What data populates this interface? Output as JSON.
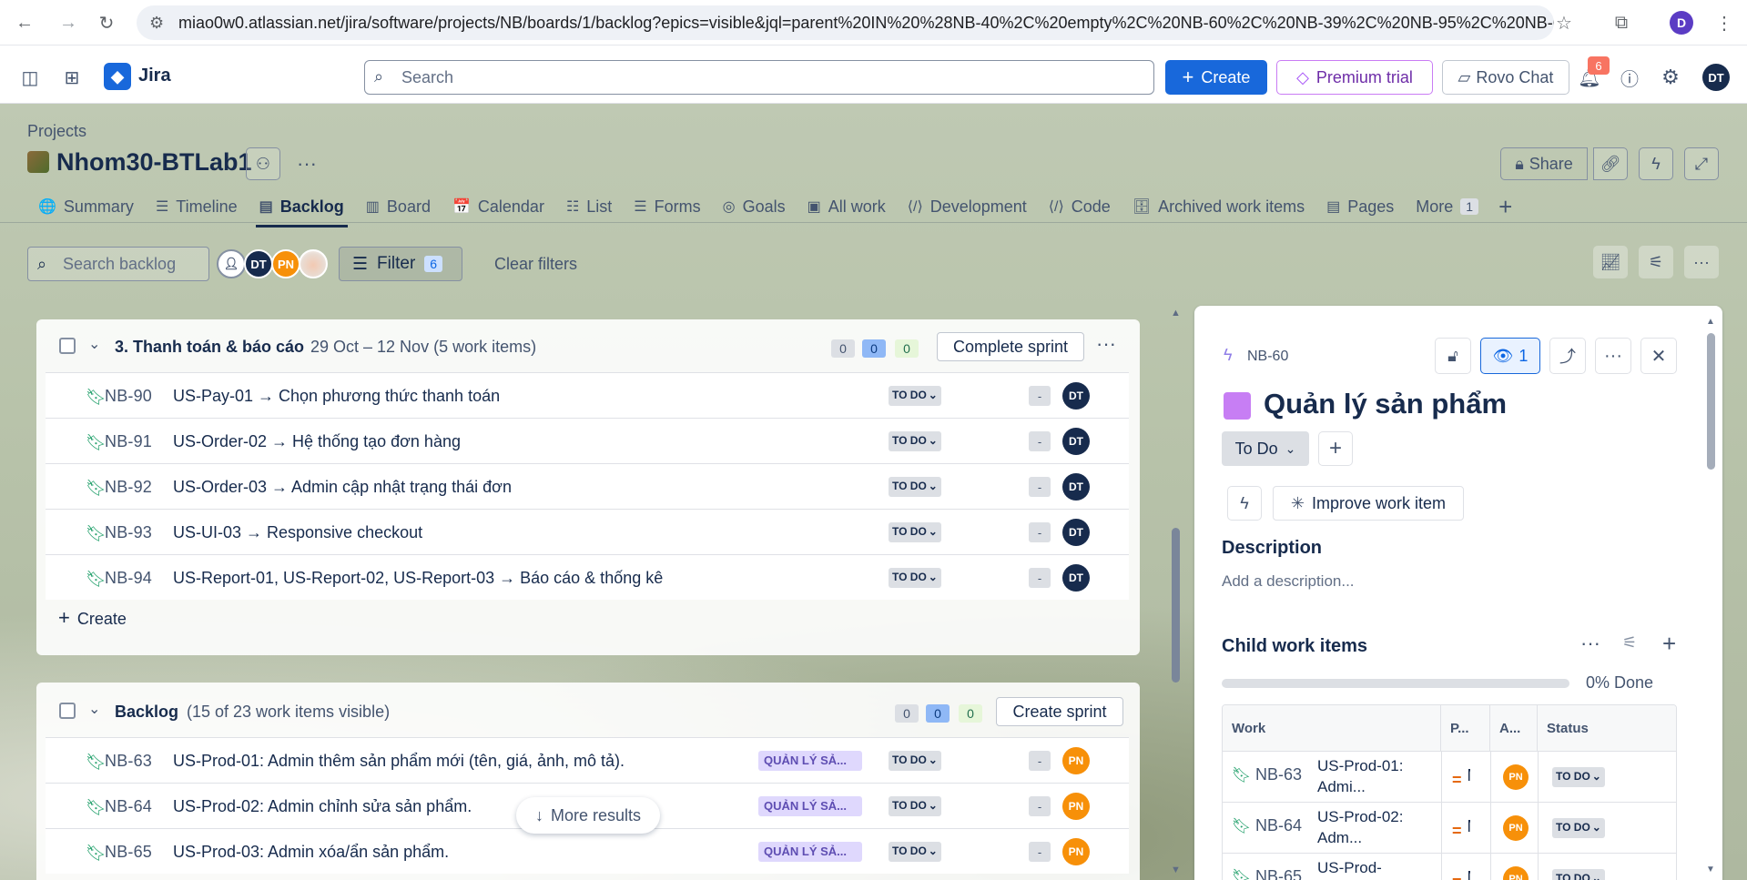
{
  "browser": {
    "url": "miao0w0.atlassian.net/jira/software/projects/NB/boards/1/backlog?epics=visible&jql=parent%20IN%20%28NB-40%2C%20empty%2C%20NB-60%2C%20NB-39%2C%20NB-95%2C%20NB-62%...",
    "profile_initial": "D"
  },
  "topnav": {
    "app_name": "Jira",
    "search_placeholder": "Search",
    "create_label": "Create",
    "premium_label": "Premium trial",
    "rovo_label": "Rovo Chat",
    "notification_count": "6",
    "avatar_initials": "DT"
  },
  "project": {
    "breadcrumb": "Projects",
    "name": "Nhom30-BTLab1",
    "share_label": "Share"
  },
  "tabs": [
    {
      "label": "Summary",
      "icon": "globe-icon",
      "glyph": "🌐"
    },
    {
      "label": "Timeline",
      "icon": "timeline-icon",
      "glyph": "☰"
    },
    {
      "label": "Backlog",
      "icon": "backlog-icon",
      "glyph": "▤",
      "active": true
    },
    {
      "label": "Board",
      "icon": "board-icon",
      "glyph": "▥"
    },
    {
      "label": "Calendar",
      "icon": "calendar-icon",
      "glyph": "📅"
    },
    {
      "label": "List",
      "icon": "list-icon",
      "glyph": "☷"
    },
    {
      "label": "Forms",
      "icon": "forms-icon",
      "glyph": "☰"
    },
    {
      "label": "Goals",
      "icon": "goals-icon",
      "glyph": "◎"
    },
    {
      "label": "All work",
      "icon": "all-work-icon",
      "glyph": "▣"
    },
    {
      "label": "Development",
      "icon": "development-icon",
      "glyph": "⟨/⟩"
    },
    {
      "label": "Code",
      "icon": "code-icon",
      "glyph": "⟨/⟩"
    },
    {
      "label": "Archived work items",
      "icon": "archive-icon",
      "glyph": "🗄"
    },
    {
      "label": "Pages",
      "icon": "pages-icon",
      "glyph": "▤"
    },
    {
      "label": "More",
      "icon": "",
      "glyph": "",
      "badge": "1"
    }
  ],
  "toolbar": {
    "search_placeholder": "Search backlog",
    "avatars": [
      {
        "initials": "",
        "color": "#ffffff"
      },
      {
        "initials": "DT",
        "color": "#172b4d"
      },
      {
        "initials": "PN",
        "color": "#f79009"
      },
      {
        "initials": "",
        "color": "#f4d9c7"
      }
    ],
    "filter_label": "Filter",
    "filter_count": "6",
    "clear_filters": "Clear filters"
  },
  "sprint": {
    "name": "3. Thanh toán & báo cáo",
    "dates": "29 Oct – 12 Nov (5 work items)",
    "counts": [
      "0",
      "0",
      "0"
    ],
    "action": "Complete sprint",
    "create_label": "Create",
    "items": [
      {
        "key": "NB-90",
        "summary": "US-Pay-01 → Chọn phương thức thanh toán",
        "status": "TO DO",
        "estimate": "-",
        "assignee": "DT"
      },
      {
        "key": "NB-91",
        "summary": "US-Order-02 → Hệ thống tạo đơn hàng",
        "status": "TO DO",
        "estimate": "-",
        "assignee": "DT"
      },
      {
        "key": "NB-92",
        "summary": "US-Order-03 → Admin cập nhật trạng thái đơn",
        "status": "TO DO",
        "estimate": "-",
        "assignee": "DT"
      },
      {
        "key": "NB-93",
        "summary": "US-UI-03 → Responsive checkout",
        "status": "TO DO",
        "estimate": "-",
        "assignee": "DT"
      },
      {
        "key": "NB-94",
        "summary": "US-Report-01, US-Report-02, US-Report-03 → Báo cáo & thống kê",
        "status": "TO DO",
        "estimate": "-",
        "assignee": "DT"
      }
    ]
  },
  "backlog": {
    "name": "Backlog",
    "visible": "(15 of 23 work items visible)",
    "counts": [
      "0",
      "0",
      "0"
    ],
    "action": "Create sprint",
    "more_results": "More results",
    "items": [
      {
        "key": "NB-63",
        "summary": "US-Prod-01: Admin thêm sản phẩm mới (tên, giá, ảnh, mô tả).",
        "epic": "QUẢN LÝ SẢ...",
        "status": "TO DO",
        "estimate": "-",
        "assignee": "PN"
      },
      {
        "key": "NB-64",
        "summary": "US-Prod-02: Admin chỉnh sửa sản phẩm.",
        "epic": "QUẢN LÝ SẢ...",
        "status": "TO DO",
        "estimate": "-",
        "assignee": "PN"
      },
      {
        "key": "NB-65",
        "summary": "US-Prod-03: Admin xóa/ẩn sản phẩm.",
        "epic": "QUẢN LÝ SẢ...",
        "status": "TO DO",
        "estimate": "-",
        "assignee": "PN"
      }
    ]
  },
  "detail": {
    "key": "NB-60",
    "watch_count": "1",
    "title": "Quản lý sản phẩm",
    "epic_color": "#c77ef4",
    "status": "To Do",
    "improve_label": "Improve work item",
    "description_heading": "Description",
    "description_placeholder": "Add a description...",
    "child_heading": "Child work items",
    "progress_percent": 0,
    "done_label": "0% Done",
    "columns": [
      "Work",
      "P...",
      "A...",
      "Status"
    ],
    "children": [
      {
        "key": "NB-63",
        "summary": "US-Prod-01: Admi...",
        "priority": "=",
        "priority_letter": "M",
        "assignee": "PN",
        "status": "TO DO"
      },
      {
        "key": "NB-64",
        "summary": "US-Prod-02: Adm...",
        "priority": "=",
        "priority_letter": "M",
        "assignee": "PN",
        "status": "TO DO"
      },
      {
        "key": "NB-65",
        "summary": "US-Prod-",
        "priority": "=",
        "priority_letter": "M",
        "assignee": "PN",
        "status": "TO DO"
      }
    ]
  }
}
